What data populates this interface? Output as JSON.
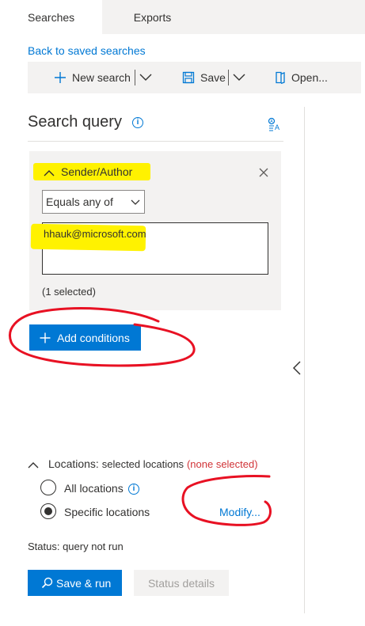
{
  "tabs": [
    {
      "label": "Searches",
      "active": true
    },
    {
      "label": "Exports",
      "active": false
    }
  ],
  "back_link": "Back to saved searches",
  "toolbar": {
    "new_search": "New search",
    "save": "Save",
    "open": "Open..."
  },
  "search_query": {
    "title": "Search query",
    "condition": {
      "title": "Sender/Author",
      "operator": "Equals any of",
      "value": "hhauk@microsoft.com",
      "selected_count": "(1 selected)"
    },
    "add_conditions": "Add conditions"
  },
  "locations": {
    "label": "Locations:",
    "value": "selected locations",
    "warning": "(none selected)",
    "options": [
      {
        "label": "All locations",
        "selected": false
      },
      {
        "label": "Specific locations",
        "selected": true
      }
    ],
    "modify": "Modify..."
  },
  "status": "Status: query not run",
  "buttons": {
    "save_run": "Save & run",
    "status_details": "Status details"
  },
  "colors": {
    "accent": "#0078d4",
    "highlight": "#fff200",
    "annotation": "#e81123",
    "warning": "#d13438"
  }
}
